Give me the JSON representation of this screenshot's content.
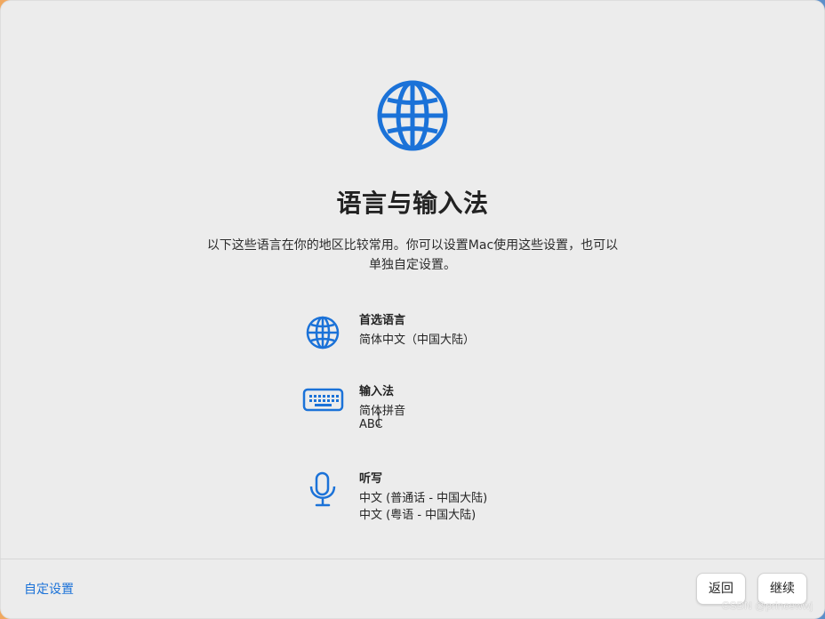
{
  "page": {
    "title": "语言与输入法",
    "description_line_1": "以下这些语言在你的地区比较常用。你可以设置Mac使用这些设置，也可以",
    "description_line_2": "单独自定设置。"
  },
  "settings": {
    "language": {
      "icon": "globe-icon",
      "title": "首选语言",
      "value": "简体中文（中国大陆）"
    },
    "input": {
      "icon": "keyboard-icon",
      "title": "输入法",
      "value_1": "简体拼音",
      "value_2": "ABC"
    },
    "dictation": {
      "icon": "microphone-icon",
      "title": "听写",
      "value_1": "中文 (普通话 - 中国大陆)",
      "value_2": "中文 (粤语 - 中国大陆)"
    }
  },
  "footer": {
    "custom_settings": "自定设置",
    "back": "返回",
    "continue": "继续"
  },
  "watermark": "CSDN @princewwj",
  "colors": {
    "accent": "#1b72d8",
    "window": "#ececec",
    "text": "#222222"
  }
}
